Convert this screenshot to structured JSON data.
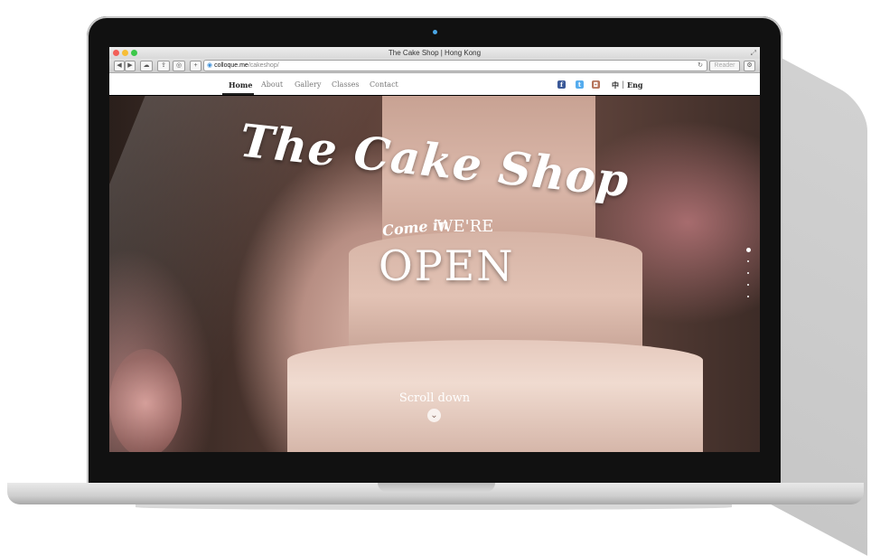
{
  "browser": {
    "window_title": "The Cake Shop | Hong Kong",
    "url_domain": "colloque.me",
    "url_path": "/cakeshop/",
    "reader_label": "Reader"
  },
  "nav": {
    "items": [
      "Home",
      "About",
      "Gallery",
      "Classes",
      "Contact"
    ],
    "active": "Home",
    "language_chinese": "中",
    "language_separator": "|",
    "language_english": "Eng"
  },
  "social": {
    "facebook_color": "#3b5998",
    "twitter_color": "#55acee",
    "instagram_color": "#b5735a"
  },
  "hero": {
    "brand": "The Cake Shop",
    "come_in": "Come in",
    "were": "WE'RE",
    "open": "OPEN",
    "scroll_label": "Scroll down",
    "scroll_icon": "chevron-down-icon",
    "page_dots_count": 5,
    "page_dots_active_index": 0
  }
}
